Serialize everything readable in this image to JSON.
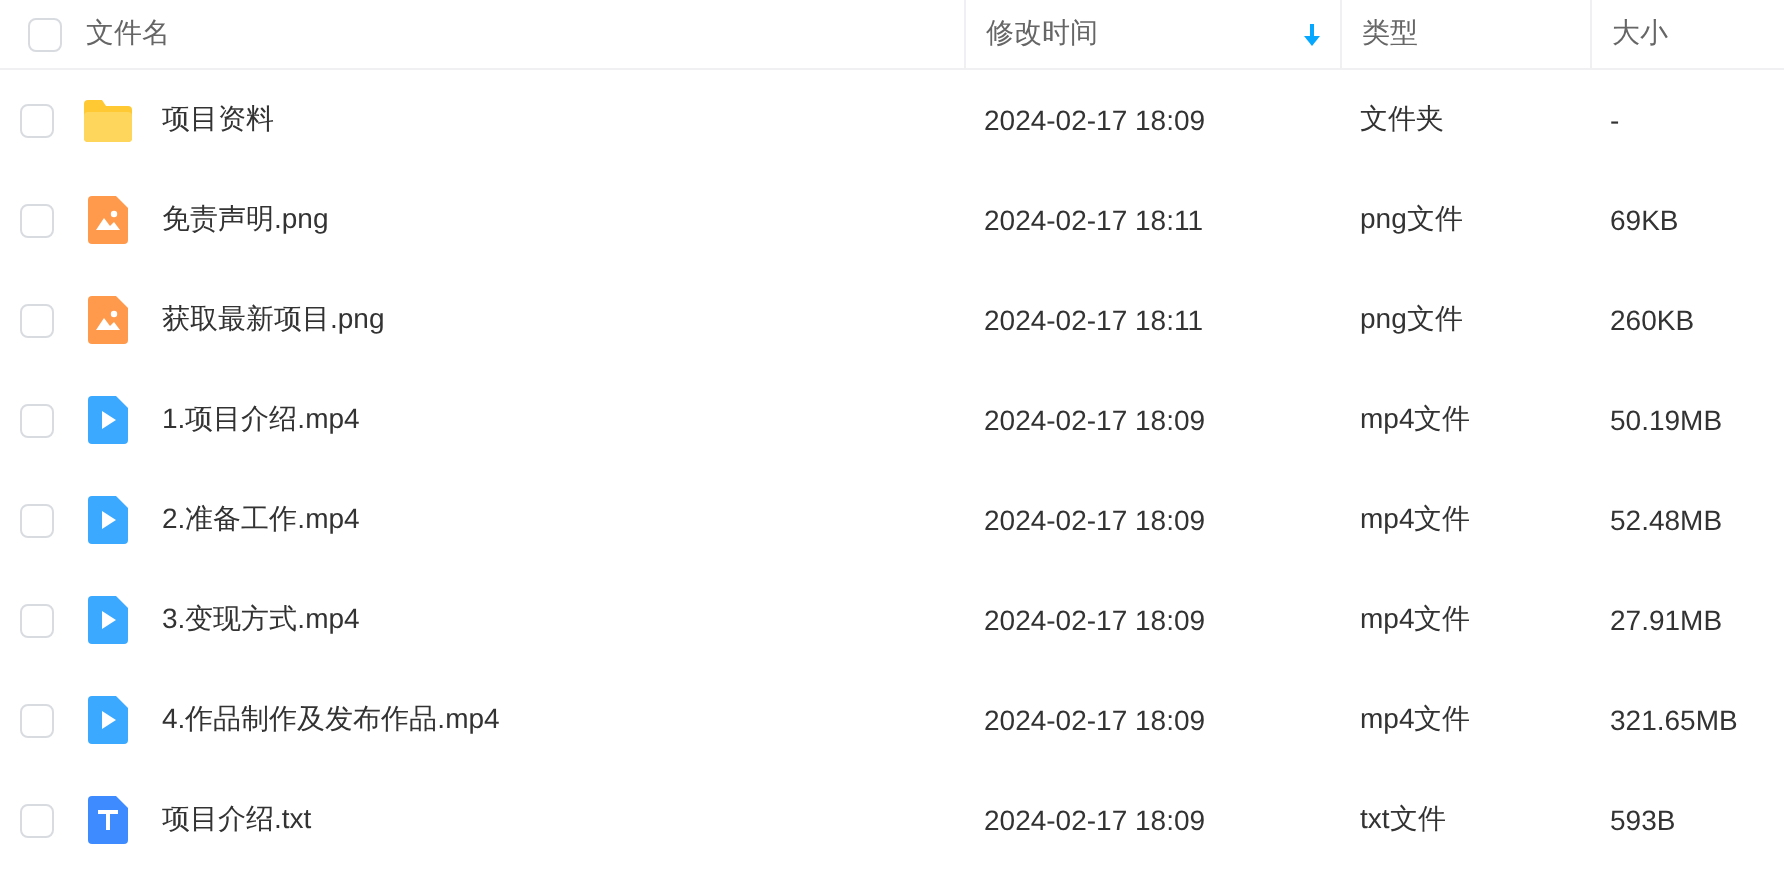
{
  "header": {
    "checked": false,
    "columns": [
      {
        "label": "文件名",
        "sorted": false
      },
      {
        "label": "修改时间",
        "sorted": true
      },
      {
        "label": "类型",
        "sorted": false
      },
      {
        "label": "大小",
        "sorted": false
      }
    ]
  },
  "files": [
    {
      "kind": "folder",
      "checked": false,
      "name": "项目资料",
      "modified": "2024-02-17 18:09",
      "type": "文件夹",
      "size": "-"
    },
    {
      "kind": "image",
      "checked": false,
      "name": "免责声明.png",
      "modified": "2024-02-17 18:11",
      "type": "png文件",
      "size": "69KB"
    },
    {
      "kind": "image",
      "checked": false,
      "name": "获取最新项目.png",
      "modified": "2024-02-17 18:11",
      "type": "png文件",
      "size": "260KB"
    },
    {
      "kind": "video",
      "checked": false,
      "name": "1.项目介绍.mp4",
      "modified": "2024-02-17 18:09",
      "type": "mp4文件",
      "size": "50.19MB"
    },
    {
      "kind": "video",
      "checked": false,
      "name": "2.准备工作.mp4",
      "modified": "2024-02-17 18:09",
      "type": "mp4文件",
      "size": "52.48MB"
    },
    {
      "kind": "video",
      "checked": false,
      "name": "3.变现方式.mp4",
      "modified": "2024-02-17 18:09",
      "type": "mp4文件",
      "size": "27.91MB"
    },
    {
      "kind": "video",
      "checked": false,
      "name": "4.作品制作及发布作品.mp4",
      "modified": "2024-02-17 18:09",
      "type": "mp4文件",
      "size": "321.65MB"
    },
    {
      "kind": "text",
      "checked": false,
      "name": "项目介绍.txt",
      "modified": "2024-02-17 18:09",
      "type": "txt文件",
      "size": "593B"
    }
  ]
}
